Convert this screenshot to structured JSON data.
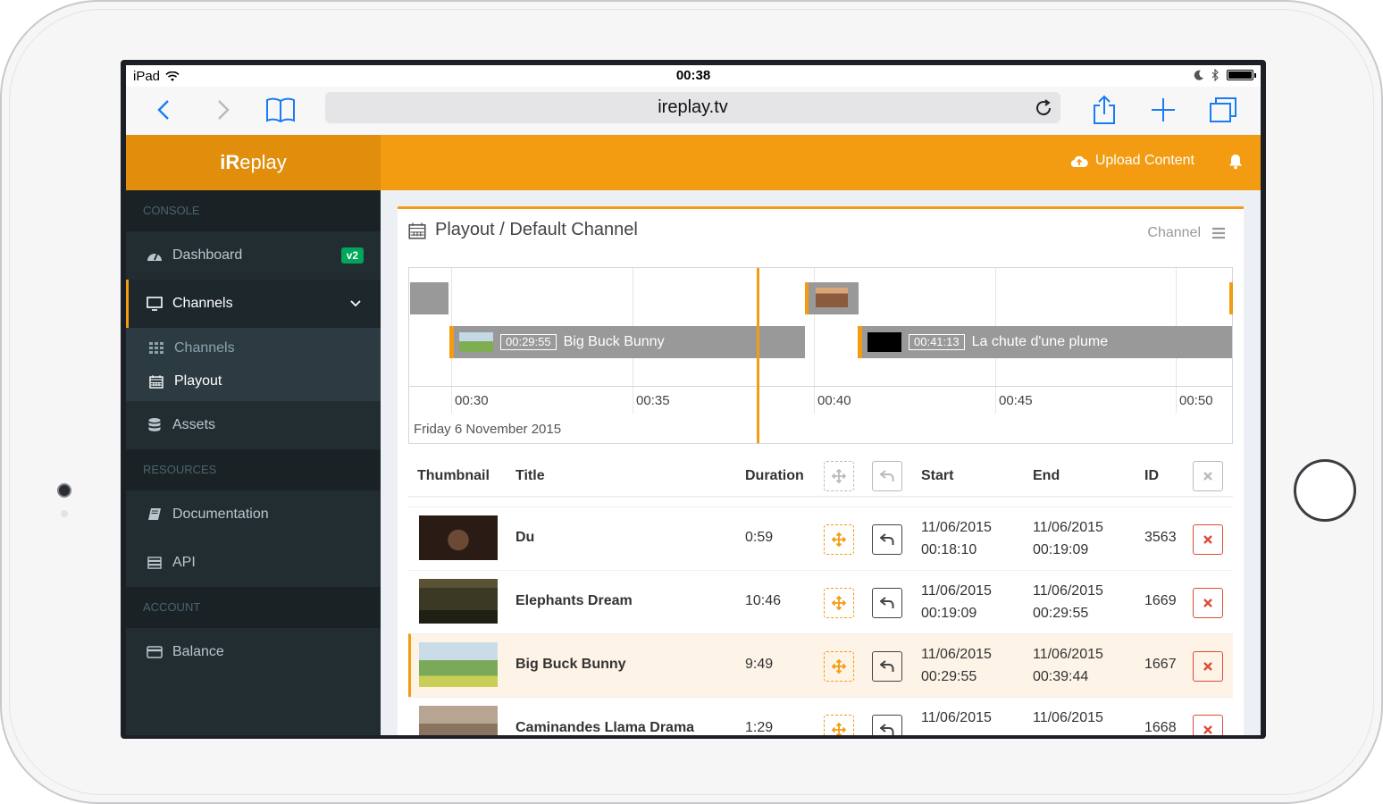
{
  "device": {
    "status": {
      "device_name": "iPad",
      "time": "00:38"
    }
  },
  "browser": {
    "url": "ireplay.tv"
  },
  "app": {
    "brand_bold": "iR",
    "brand_rest": "eplay",
    "upload_label": "Upload Content"
  },
  "sidebar": {
    "console_header": "CONSOLE",
    "dashboard": "Dashboard",
    "dashboard_badge": "v2",
    "channels": "Channels",
    "sub_channels": "Channels",
    "sub_playout": "Playout",
    "assets": "Assets",
    "resources_header": "RESOURCES",
    "documentation": "Documentation",
    "api": "API",
    "account_header": "ACCOUNT",
    "balance": "Balance"
  },
  "box": {
    "title": "Playout / Default Channel",
    "tools_label": "Channel"
  },
  "timeline": {
    "ticks": [
      "00:30",
      "00:35",
      "00:40",
      "00:45",
      "00:50"
    ],
    "date": "Friday 6 November 2015",
    "blocks": [
      {
        "duration": "00:29:55",
        "title": "Big Buck Bunny"
      },
      {
        "duration": "00:41:13",
        "title": "La chute d'une plume"
      }
    ]
  },
  "table": {
    "headers": {
      "thumbnail": "Thumbnail",
      "title": "Title",
      "duration": "Duration",
      "start": "Start",
      "end": "End",
      "id": "ID"
    },
    "rows": [
      {
        "title": "Du",
        "duration": "0:59",
        "start_date": "11/06/2015",
        "start_time": "00:18:10",
        "end_date": "11/06/2015",
        "end_time": "00:19:09",
        "id": "3563"
      },
      {
        "title": "Elephants Dream",
        "duration": "10:46",
        "start_date": "11/06/2015",
        "start_time": "00:19:09",
        "end_date": "11/06/2015",
        "end_time": "00:29:55",
        "id": "1669"
      },
      {
        "title": "Big Buck Bunny",
        "duration": "9:49",
        "start_date": "11/06/2015",
        "start_time": "00:29:55",
        "end_date": "11/06/2015",
        "end_time": "00:39:44",
        "id": "1667"
      },
      {
        "title": "Caminandes Llama Drama",
        "duration": "1:29",
        "start_date": "11/06/2015",
        "start_time": "",
        "end_date": "11/06/2015",
        "end_time": "",
        "id": "1668"
      }
    ]
  }
}
